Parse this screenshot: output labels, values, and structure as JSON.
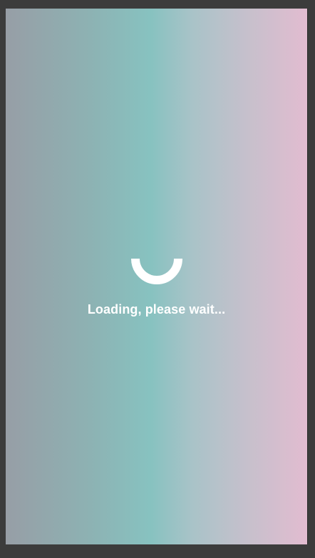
{
  "loading": {
    "message": "Loading, please wait..."
  },
  "icons": {
    "spinner": "loading-spinner-icon"
  },
  "colors": {
    "gradient_stops": [
      "#979ea6",
      "#8db2b3",
      "#87c2c0",
      "#a9c3c8",
      "#c6c0cc",
      "#e2bcd0"
    ],
    "spinner": "#ffffff",
    "text": "#ffffff",
    "window_frame": "#3c3c3c"
  }
}
